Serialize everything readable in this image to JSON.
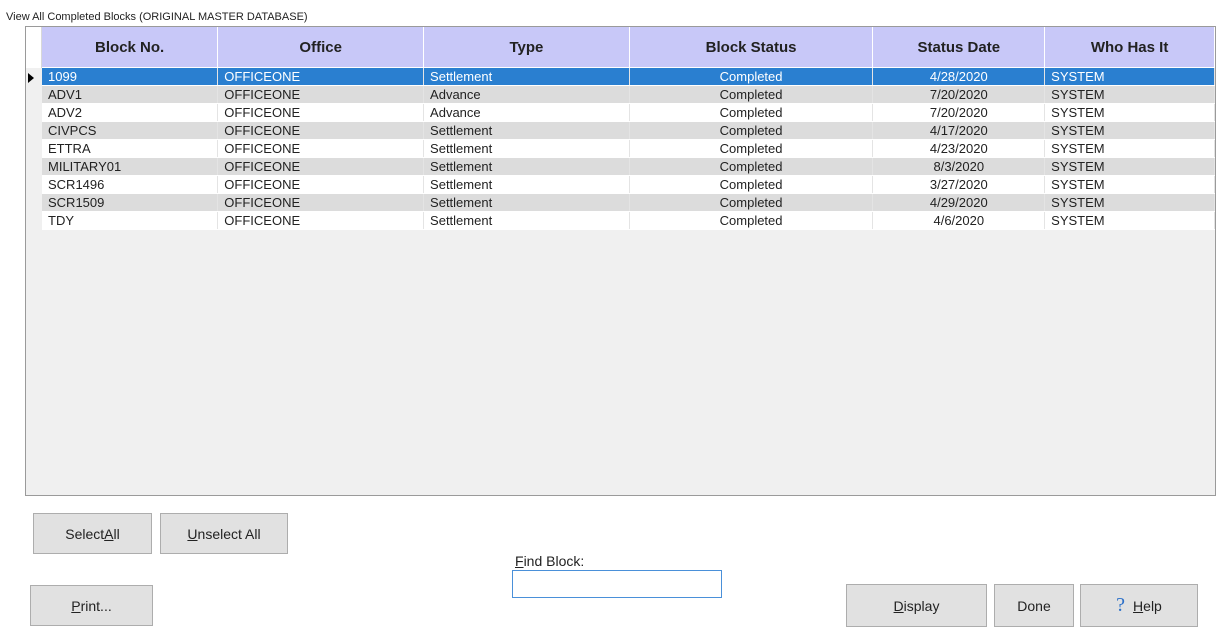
{
  "window": {
    "title": "View All Completed Blocks (ORIGINAL MASTER DATABASE)"
  },
  "grid": {
    "columns": [
      "Block No.",
      "Office",
      "Type",
      "Block Status",
      "Status Date",
      "Who Has It"
    ],
    "rows": [
      {
        "block": "1099",
        "office": "OFFICEONE",
        "type": "Settlement",
        "status": "Completed",
        "date": "4/28/2020",
        "who": "SYSTEM",
        "selected": true
      },
      {
        "block": "ADV1",
        "office": "OFFICEONE",
        "type": "Advance",
        "status": "Completed",
        "date": "7/20/2020",
        "who": "SYSTEM",
        "selected": false
      },
      {
        "block": "ADV2",
        "office": "OFFICEONE",
        "type": "Advance",
        "status": "Completed",
        "date": "7/20/2020",
        "who": "SYSTEM",
        "selected": false
      },
      {
        "block": "CIVPCS",
        "office": "OFFICEONE",
        "type": "Settlement",
        "status": "Completed",
        "date": "4/17/2020",
        "who": "SYSTEM",
        "selected": false
      },
      {
        "block": "ETTRA",
        "office": "OFFICEONE",
        "type": "Settlement",
        "status": "Completed",
        "date": "4/23/2020",
        "who": "SYSTEM",
        "selected": false
      },
      {
        "block": "MILITARY01",
        "office": "OFFICEONE",
        "type": "Settlement",
        "status": "Completed",
        "date": "8/3/2020",
        "who": "SYSTEM",
        "selected": false
      },
      {
        "block": "SCR1496",
        "office": "OFFICEONE",
        "type": "Settlement",
        "status": "Completed",
        "date": "3/27/2020",
        "who": "SYSTEM",
        "selected": false
      },
      {
        "block": "SCR1509",
        "office": "OFFICEONE",
        "type": "Settlement",
        "status": "Completed",
        "date": "4/29/2020",
        "who": "SYSTEM",
        "selected": false
      },
      {
        "block": "TDY",
        "office": "OFFICEONE",
        "type": "Settlement",
        "status": "Completed",
        "date": "4/6/2020",
        "who": "SYSTEM",
        "selected": false
      }
    ]
  },
  "buttons": {
    "select_all": {
      "pre": "Select ",
      "ul": "A",
      "post": "ll"
    },
    "unselect_all": {
      "pre": "",
      "ul": "U",
      "post": "nselect All"
    },
    "print": {
      "pre": "",
      "ul": "P",
      "post": "rint..."
    },
    "display": {
      "pre": "",
      "ul": "D",
      "post": "isplay"
    },
    "done": {
      "pre": "Done",
      "ul": "",
      "post": ""
    },
    "help": {
      "pre": "",
      "ul": "H",
      "post": "elp"
    }
  },
  "find": {
    "label_ul": "F",
    "label_rest": "ind Block:",
    "value": ""
  },
  "colors": {
    "header_bg": "#c8c8f8",
    "selected_row": "#2a7fd0",
    "alt_row": "#dcdcdc"
  }
}
